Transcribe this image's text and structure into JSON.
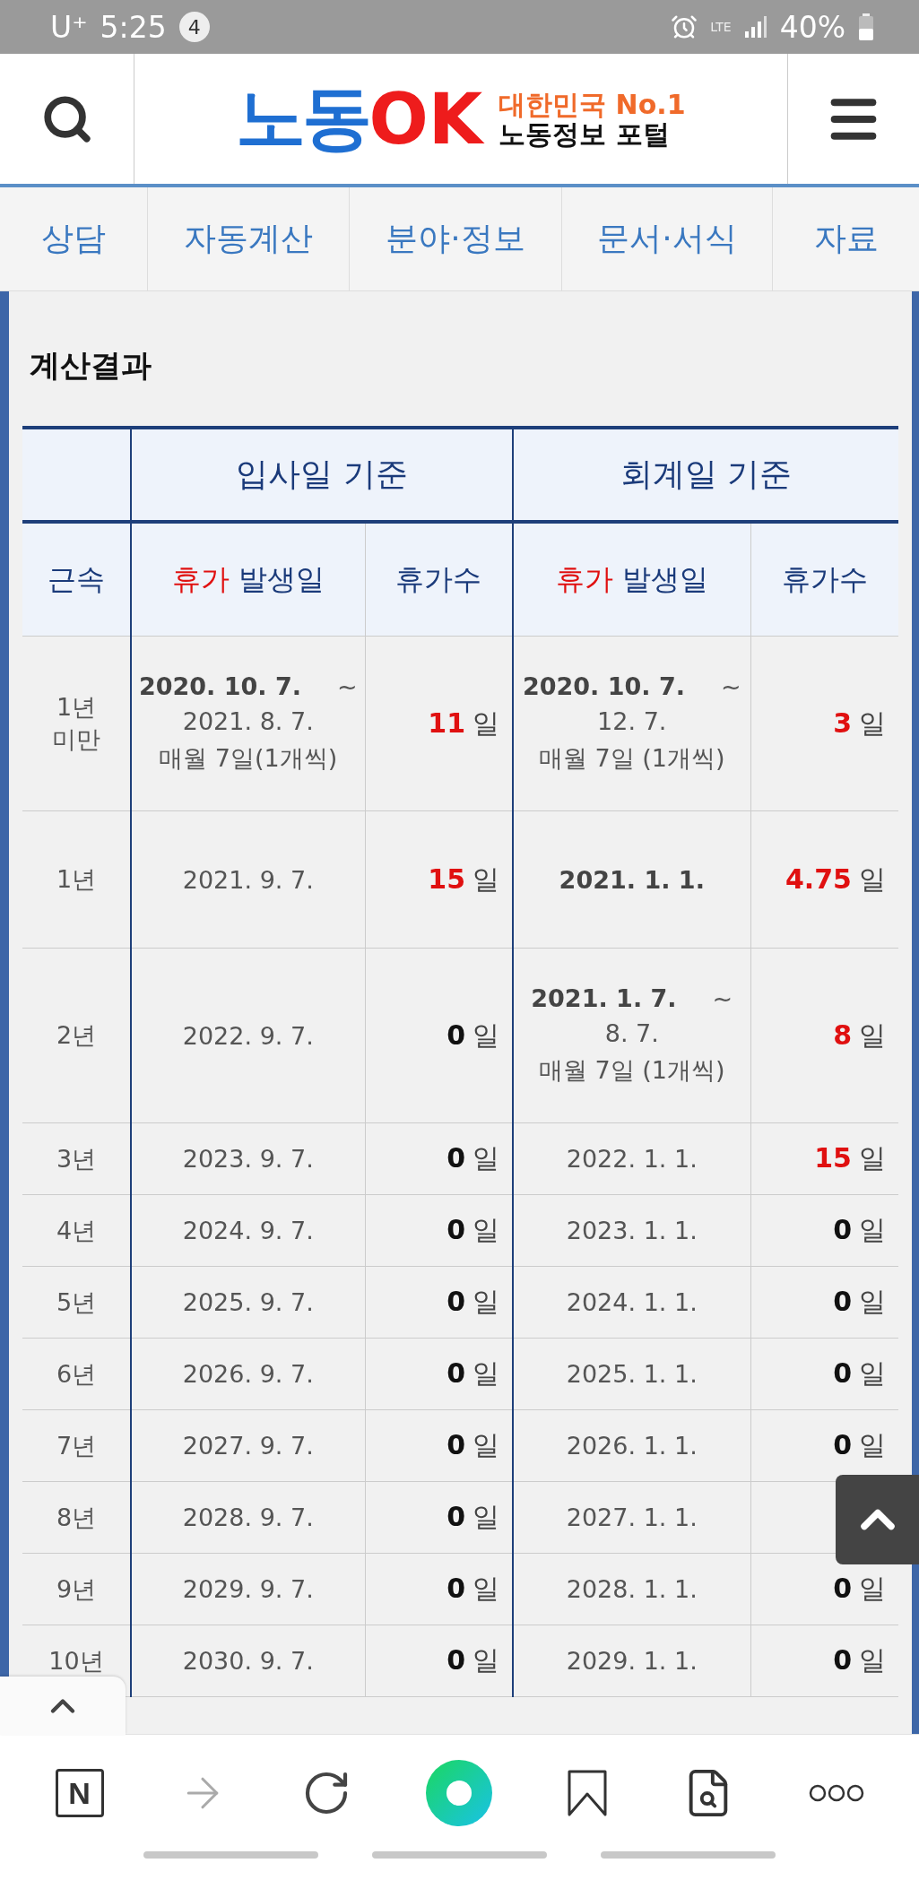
{
  "status_bar": {
    "carrier": "U⁺",
    "time": "5:25",
    "notification_count": "4",
    "network": "LTE",
    "battery": "40%"
  },
  "header": {
    "logo_main": "노동",
    "logo_ok": "OK",
    "tagline_top": "대한민국 No.1",
    "tagline_bottom": "노동정보 포털"
  },
  "nav": [
    {
      "label": "상담"
    },
    {
      "label": "자동계산"
    },
    {
      "label": "분야·정보"
    },
    {
      "label": "문서·서식"
    },
    {
      "label": "자료"
    }
  ],
  "section_title": "계산결과",
  "table": {
    "group_headers": [
      "입사일 기준",
      "회계일 기준"
    ],
    "columns": [
      {
        "label": "근속"
      },
      {
        "accent": "휴가",
        "label": "발생일"
      },
      {
        "label": "휴가수"
      },
      {
        "accent": "휴가",
        "label": "발생일"
      },
      {
        "label": "휴가수"
      }
    ],
    "rows": [
      {
        "tenure": [
          "1년",
          "미만"
        ],
        "hire_date": {
          "lines": [
            {
              "text": "2020. 10. 7.",
              "strong": true
            },
            {
              "text": "2021. 8. 7.",
              "strong": false
            },
            {
              "text": "매월 7일(1개씩)",
              "strong": false
            }
          ],
          "range_mark": "~"
        },
        "hire_days": {
          "value": "11",
          "unit": "일",
          "highlight": true
        },
        "fiscal_date": {
          "lines": [
            {
              "text": "2020. 10. 7.",
              "strong": true
            },
            {
              "text": "12. 7.",
              "strong": false
            },
            {
              "text": "매월 7일 (1개씩)",
              "strong": false
            }
          ],
          "range_mark": "~"
        },
        "fiscal_days": {
          "value": "3",
          "unit": "일",
          "highlight": true
        }
      },
      {
        "tenure": [
          "1년"
        ],
        "hire_date": {
          "lines": [
            {
              "text": "2021. 9. 7.",
              "strong": false
            }
          ]
        },
        "hire_days": {
          "value": "15",
          "unit": "일",
          "highlight": true
        },
        "fiscal_date": {
          "lines": [
            {
              "text": "2021. 1. 1.",
              "strong": true
            }
          ]
        },
        "fiscal_days": {
          "value": "4.75",
          "unit": "일",
          "highlight": true
        }
      },
      {
        "tenure": [
          "2년"
        ],
        "hire_date": {
          "lines": [
            {
              "text": "2022. 9. 7.",
              "strong": false
            }
          ]
        },
        "hire_days": {
          "value": "0",
          "unit": "일",
          "highlight": false
        },
        "fiscal_date": {
          "lines": [
            {
              "text": "2021. 1. 7.",
              "strong": true
            },
            {
              "text": "8. 7.",
              "strong": false
            },
            {
              "text": "매월 7일 (1개씩)",
              "strong": false
            }
          ],
          "range_mark": "~"
        },
        "fiscal_days": {
          "value": "8",
          "unit": "일",
          "highlight": true
        }
      },
      {
        "tenure": [
          "3년"
        ],
        "hire_date": {
          "lines": [
            {
              "text": "2023. 9. 7.",
              "strong": false
            }
          ]
        },
        "hire_days": {
          "value": "0",
          "unit": "일",
          "highlight": false
        },
        "fiscal_date": {
          "lines": [
            {
              "text": "2022. 1. 1.",
              "strong": false
            }
          ]
        },
        "fiscal_days": {
          "value": "15",
          "unit": "일",
          "highlight": true
        }
      },
      {
        "tenure": [
          "4년"
        ],
        "hire_date": {
          "lines": [
            {
              "text": "2024. 9. 7.",
              "strong": false
            }
          ]
        },
        "hire_days": {
          "value": "0",
          "unit": "일",
          "highlight": false
        },
        "fiscal_date": {
          "lines": [
            {
              "text": "2023. 1. 1.",
              "strong": false
            }
          ]
        },
        "fiscal_days": {
          "value": "0",
          "unit": "일",
          "highlight": false
        }
      },
      {
        "tenure": [
          "5년"
        ],
        "hire_date": {
          "lines": [
            {
              "text": "2025. 9. 7.",
              "strong": false
            }
          ]
        },
        "hire_days": {
          "value": "0",
          "unit": "일",
          "highlight": false
        },
        "fiscal_date": {
          "lines": [
            {
              "text": "2024. 1. 1.",
              "strong": false
            }
          ]
        },
        "fiscal_days": {
          "value": "0",
          "unit": "일",
          "highlight": false
        }
      },
      {
        "tenure": [
          "6년"
        ],
        "hire_date": {
          "lines": [
            {
              "text": "2026. 9. 7.",
              "strong": false
            }
          ]
        },
        "hire_days": {
          "value": "0",
          "unit": "일",
          "highlight": false
        },
        "fiscal_date": {
          "lines": [
            {
              "text": "2025. 1. 1.",
              "strong": false
            }
          ]
        },
        "fiscal_days": {
          "value": "0",
          "unit": "일",
          "highlight": false
        }
      },
      {
        "tenure": [
          "7년"
        ],
        "hire_date": {
          "lines": [
            {
              "text": "2027. 9. 7.",
              "strong": false
            }
          ]
        },
        "hire_days": {
          "value": "0",
          "unit": "일",
          "highlight": false
        },
        "fiscal_date": {
          "lines": [
            {
              "text": "2026. 1. 1.",
              "strong": false
            }
          ]
        },
        "fiscal_days": {
          "value": "0",
          "unit": "일",
          "highlight": false
        }
      },
      {
        "tenure": [
          "8년"
        ],
        "hire_date": {
          "lines": [
            {
              "text": "2028. 9. 7.",
              "strong": false
            }
          ]
        },
        "hire_days": {
          "value": "0",
          "unit": "일",
          "highlight": false
        },
        "fiscal_date": {
          "lines": [
            {
              "text": "2027. 1. 1.",
              "strong": false
            }
          ]
        }
      },
      {
        "tenure": [
          "9년"
        ],
        "hire_date": {
          "lines": [
            {
              "text": "2029. 9. 7.",
              "strong": false
            }
          ]
        },
        "hire_days": {
          "value": "0",
          "unit": "일",
          "highlight": false
        },
        "fiscal_date": {
          "lines": [
            {
              "text": "2028. 1. 1.",
              "strong": false
            }
          ]
        },
        "fiscal_days": {
          "value": "0",
          "unit": "일",
          "highlight": false
        }
      },
      {
        "tenure": [
          "10년"
        ],
        "hire_date": {
          "lines": [
            {
              "text": "2030. 9. 7.",
              "strong": false
            }
          ]
        },
        "hire_days": {
          "value": "0",
          "unit": "일",
          "highlight": false
        },
        "fiscal_date": {
          "lines": [
            {
              "text": "2029. 1. 1.",
              "strong": false
            }
          ]
        },
        "fiscal_days": {
          "value": "0",
          "unit": "일",
          "highlight": false
        }
      }
    ]
  },
  "bottom_bar": {
    "home_label": "N"
  }
}
